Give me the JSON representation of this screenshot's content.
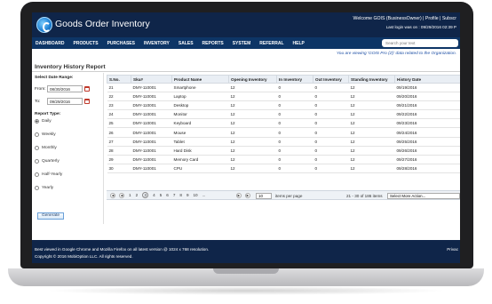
{
  "header": {
    "app_title": "Goods Order Inventory",
    "welcome": "Welcome GOIS (BusinessOwner)  |  Profile  |  Subscr",
    "last_login": "Last login was on : 09/29/2016 02:39 P"
  },
  "nav": {
    "items": [
      "DASHBOARD",
      "PRODUCTS",
      "PURCHASES",
      "INVENTORY",
      "SALES",
      "REPORTS",
      "SYSTEM",
      "REFERRAL",
      "HELP"
    ],
    "search_placeholder": "Search your text"
  },
  "notice": "You are viewing 'GOIS Pro (Z)' data related to the Organization. ",
  "page_title": "Inventory History Report",
  "filter": {
    "date_range_label": "Select Date Range:",
    "from_label": "From:",
    "from_value": "08/30/2016",
    "to_label": "To:",
    "to_value": "09/29/2016",
    "report_type_label": "Report Type:",
    "report_types": [
      "Daily",
      "Weekly",
      "Monthly",
      "Quarterly",
      "Half-Yearly",
      "Yearly"
    ],
    "selected_type": "Daily",
    "generate_label": "Generate"
  },
  "table": {
    "columns": [
      "S.No.",
      "Sku#",
      "Product Name",
      "Opening Inventory",
      "In Inventory",
      "Out Inventory",
      "Standing Inventory",
      "History Date"
    ],
    "rows": [
      [
        "21",
        "DMY-110001",
        "Smartphone",
        "12",
        "0",
        "0",
        "12",
        "09/19/2016"
      ],
      [
        "22",
        "DMY-110001",
        "Laptop",
        "12",
        "0",
        "0",
        "12",
        "09/20/2016"
      ],
      [
        "23",
        "DMY-110001",
        "Desktop",
        "12",
        "0",
        "0",
        "12",
        "09/21/2016"
      ],
      [
        "24",
        "DMY-110001",
        "Monitor",
        "12",
        "0",
        "0",
        "12",
        "09/22/2016"
      ],
      [
        "25",
        "DMY-110001",
        "Keyboard",
        "12",
        "0",
        "0",
        "12",
        "09/23/2016"
      ],
      [
        "26",
        "DMY-110001",
        "Mouse",
        "12",
        "0",
        "0",
        "12",
        "09/24/2016"
      ],
      [
        "27",
        "DMY-110001",
        "Tablet",
        "12",
        "0",
        "0",
        "12",
        "09/25/2016"
      ],
      [
        "28",
        "DMY-110001",
        "Hard Disk",
        "12",
        "0",
        "0",
        "12",
        "09/26/2016"
      ],
      [
        "29",
        "DMY-110001",
        "Memory Card",
        "12",
        "0",
        "0",
        "12",
        "09/27/2016"
      ],
      [
        "30",
        "DMY-110001",
        "CPU",
        "12",
        "0",
        "0",
        "12",
        "09/28/2016"
      ]
    ]
  },
  "pager": {
    "pages": [
      "1",
      "2",
      "3",
      "4",
      "5",
      "6",
      "7",
      "8",
      "9",
      "10",
      "..."
    ],
    "current_page": "3",
    "per_page": "10",
    "per_page_label": "items per page",
    "range_text": "21 - 30 of 186 items",
    "action_placeholder": "Select More Action..."
  },
  "footer": {
    "browser_note": "Best viewed in Google Chrome and Mozilla Firefox on all latest version @ 1024 x 768 resolution.",
    "copyright": "Copyright © 2016 MobiOption LLC. All rights reserved.",
    "privacy": "Privac"
  }
}
